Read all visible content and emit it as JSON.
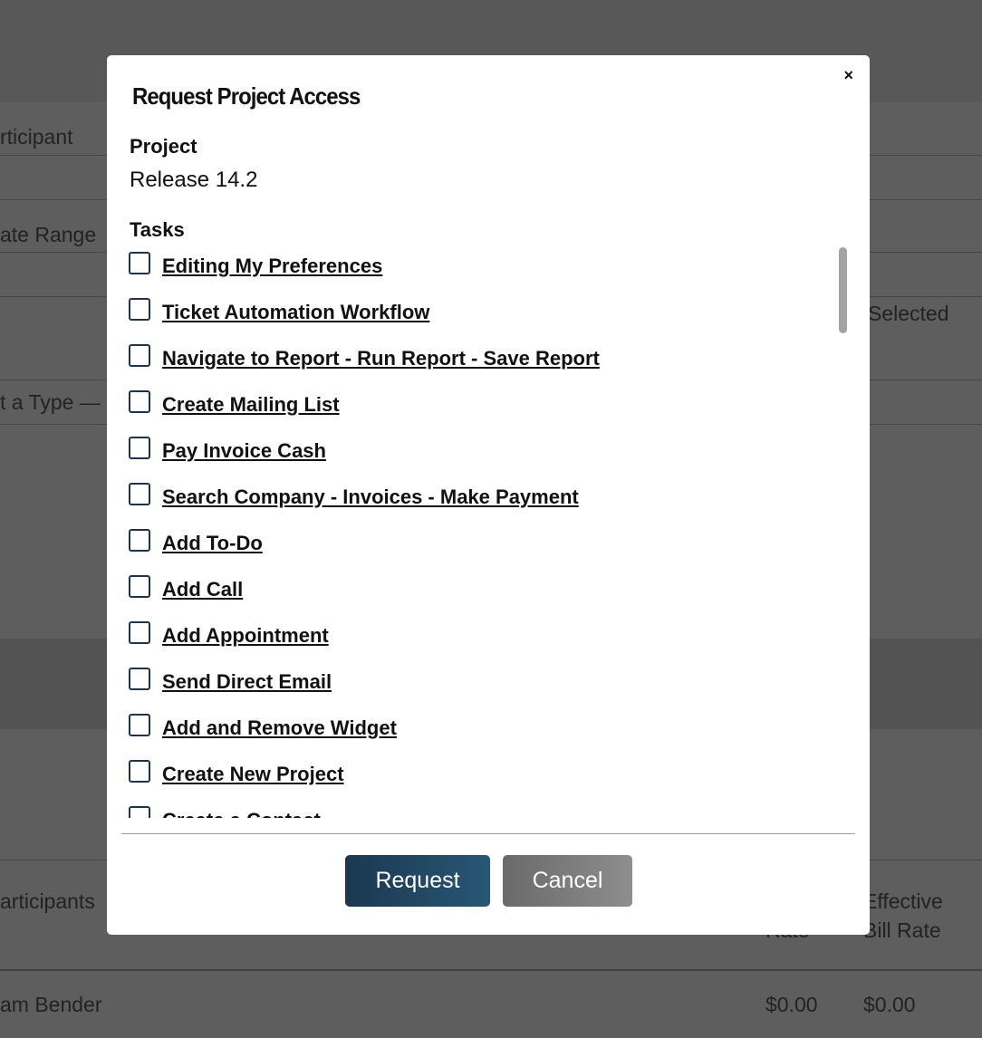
{
  "background": {
    "participant_label": "rticipant",
    "date_range_label": "ate Range",
    "selected_text": "Selected",
    "type_select": "t a Type —",
    "participants_header": "articipants",
    "rate_header": "Rate",
    "effective_bill_rate_header_line1": "Effective",
    "effective_bill_rate_header_line2": "Bill Rate",
    "row_name": "am Bender",
    "row_rate": "$0.00",
    "row_effective_rate": "$0.00"
  },
  "modal": {
    "title": "Request Project Access",
    "close_label": "×",
    "project_label": "Project",
    "project_value": "Release 14.2",
    "tasks_label": "Tasks",
    "tasks": [
      "Editing My Preferences",
      "Ticket Automation Workflow",
      "Navigate to Report - Run Report - Save Report",
      "Create Mailing List",
      "Pay Invoice Cash",
      "Search Company - Invoices - Make Payment",
      "Add To-Do",
      "Add Call",
      "Add Appointment",
      "Send Direct Email",
      "Add and Remove Widget",
      "Create New Project",
      "Create a Contact"
    ],
    "request_label": "Request",
    "cancel_label": "Cancel"
  }
}
